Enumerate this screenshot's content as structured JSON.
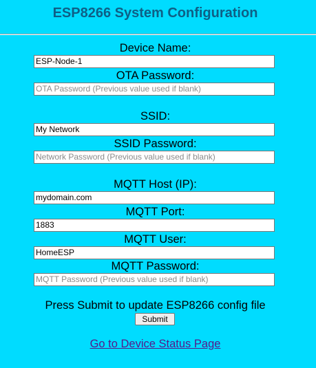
{
  "page": {
    "title": "ESP8266 System Configuration"
  },
  "form": {
    "device_name": {
      "label": "Device Name:",
      "value": "ESP-Node-1",
      "placeholder": ""
    },
    "ota_password": {
      "label": "OTA Password:",
      "value": "",
      "placeholder": "OTA Password (Previous value used if blank)"
    },
    "ssid": {
      "label": "SSID:",
      "value": "My Network",
      "placeholder": ""
    },
    "ssid_password": {
      "label": "SSID Password:",
      "value": "",
      "placeholder": "Network Password (Previous value used if blank)"
    },
    "mqtt_host": {
      "label": "MQTT Host (IP):",
      "value": "mydomain.com",
      "placeholder": ""
    },
    "mqtt_port": {
      "label": "MQTT Port:",
      "value": "1883",
      "placeholder": ""
    },
    "mqtt_user": {
      "label": "MQTT User:",
      "value": "HomeESP",
      "placeholder": ""
    },
    "mqtt_password": {
      "label": "MQTT Password:",
      "value": "",
      "placeholder": "MQTT Password (Previous value used if blank)"
    },
    "submit_instruction": "Press Submit to update ESP8266 config file",
    "submit_label": "Submit"
  },
  "footer": {
    "status_link": "Go to Device Status Page"
  },
  "colors": {
    "background": "#00dcff",
    "title": "#0e5f86",
    "link_visited": "#551a8b"
  }
}
